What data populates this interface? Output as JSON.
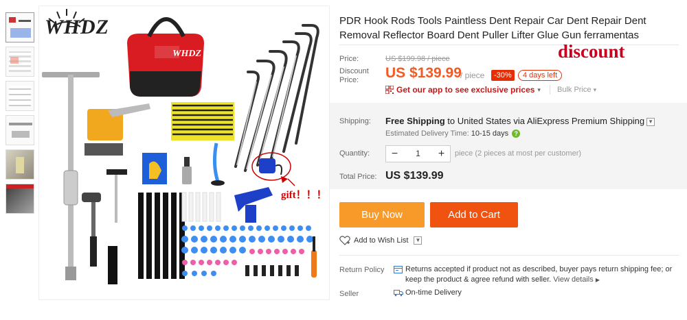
{
  "brand": {
    "logo_text": "WHDZ",
    "bag_text": "WHDZ"
  },
  "image_annotations": {
    "gift": "gift！！！",
    "discount": "discount"
  },
  "product": {
    "title": "PDR Hook Rods Tools Paintless Dent Repair Car Dent Repair Dent Removal Reflector Board Dent Puller Lifter Glue Gun ferramentas"
  },
  "pricing": {
    "price_label": "Price:",
    "original_price": "US $199.98 / piece",
    "discount_label": "Discount Price:",
    "discount_price": "US $139.99",
    "per_unit": "/ piece",
    "percent_off": "-30%",
    "days_left": "4 days left",
    "app_promo": "Get our app to see exclusive prices",
    "bulk_price": "Bulk Price"
  },
  "shipping": {
    "label": "Shipping:",
    "free_prefix": "Free Shipping",
    "destination": " to United States via AliExpress Premium Shipping",
    "estimate_label": "Estimated Delivery Time:",
    "estimate_value": "10-15 days"
  },
  "quantity": {
    "label": "Quantity:",
    "value": "1",
    "note": "piece (2 pieces at most per customer)"
  },
  "total": {
    "label": "Total Price:",
    "value": "US $139.99"
  },
  "actions": {
    "buy_now": "Buy Now",
    "add_to_cart": "Add to Cart",
    "wishlist": "Add to Wish List"
  },
  "policies": {
    "return_label": "Return Policy",
    "return_text": "Returns accepted if product not as described, buyer pays return shipping fee; or keep the product & agree refund with seller.",
    "view_details": "View details",
    "seller_label": "Seller",
    "seller_text": "On-time Delivery"
  },
  "colors": {
    "price": "#f15a24",
    "buy_now": "#f79a2a",
    "add_to_cart": "#f0520f",
    "badge": "#e62e04",
    "annotation": "#c8001e"
  }
}
